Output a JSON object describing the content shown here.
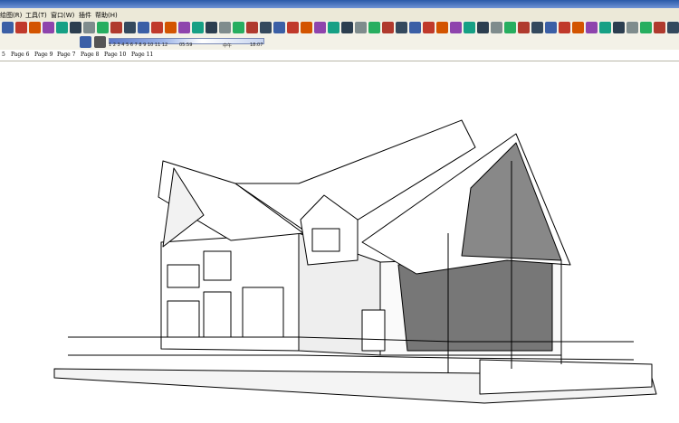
{
  "menu": [
    "绘图(R)",
    "工具(T)",
    "窗口(W)",
    "插件",
    "帮助(H)"
  ],
  "tabs": [
    "5",
    "Page 6",
    "Page 9",
    "Page 7",
    "Page 8",
    "Page 10",
    "Page 11"
  ],
  "shadow_panel": {
    "months": "1 2 3 4 5 6 7 8 9 10 11 12",
    "time_left": "05:59",
    "noon": "中午",
    "time_right": "18:07"
  },
  "colors": {
    "accent": "#2b5aa8",
    "toolbar": "#f3f1e7"
  },
  "icons": [
    "select-icon",
    "eraser-icon",
    "paint-icon",
    "move-icon",
    "rotate-icon",
    "orbit-icon",
    "pan-icon",
    "zoom-icon",
    "zoom-extents-icon",
    "section-icon",
    "component-icon",
    "style-icon",
    "shadow-icon",
    "plugin-icon",
    "home-icon"
  ]
}
